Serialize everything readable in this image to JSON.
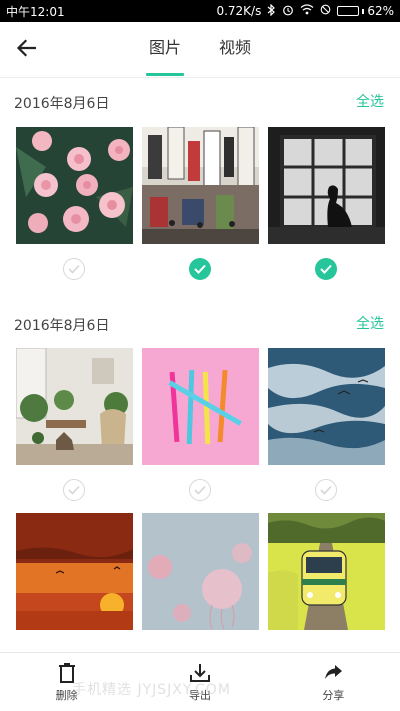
{
  "status_bar": {
    "time": "中午12:01",
    "net_speed": "0.72K/s",
    "battery": "62%",
    "battery_level": 0.62
  },
  "header": {
    "tabs": [
      {
        "label": "图片",
        "active": true
      },
      {
        "label": "视频",
        "active": false
      }
    ]
  },
  "sections": [
    {
      "date": "2016年8月6日",
      "select_all": "全选",
      "photos": [
        {
          "name": "roses",
          "selected": false
        },
        {
          "name": "street-signs",
          "selected": true
        },
        {
          "name": "window-silhouette",
          "selected": true
        }
      ]
    },
    {
      "date": "2016年8月6日",
      "select_all": "全选",
      "photos": [
        {
          "name": "living-room",
          "selected": false
        },
        {
          "name": "straws",
          "selected": false
        },
        {
          "name": "ocean-birds",
          "selected": false
        },
        {
          "name": "sunset",
          "selected": false
        },
        {
          "name": "jellyfish",
          "selected": false
        },
        {
          "name": "train-field",
          "selected": false
        }
      ]
    }
  ],
  "toolbar": {
    "delete_label": "删除",
    "export_label": "导出",
    "share_label": "分享"
  },
  "watermark": "手机精选 JYJSJXY.COM",
  "colors": {
    "accent": "#27c59a"
  },
  "icons": {
    "back": "arrow-left-icon",
    "delete": "trash-icon",
    "export": "download-icon",
    "share": "share-arrow-icon",
    "check": "check-icon"
  }
}
